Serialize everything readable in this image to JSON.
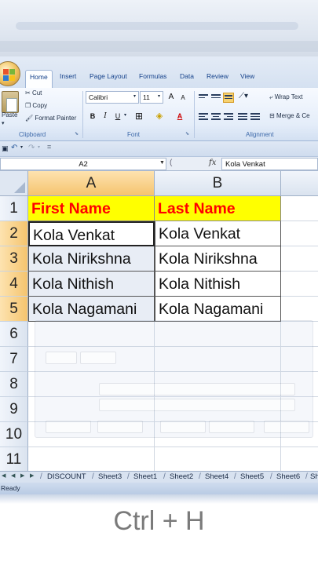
{
  "ribbon": {
    "tabs": [
      {
        "label": "Home",
        "active": true
      },
      {
        "label": "Insert"
      },
      {
        "label": "Page Layout"
      },
      {
        "label": "Formulas"
      },
      {
        "label": "Data"
      },
      {
        "label": "Review"
      },
      {
        "label": "View"
      }
    ],
    "clipboard": {
      "paste": "Paste",
      "cut": "Cut",
      "copy": "Copy",
      "format_painter": "Format Painter",
      "group_label": "Clipboard"
    },
    "font": {
      "name": "Calibri",
      "size": "11",
      "bold": "B",
      "italic": "I",
      "underline": "U",
      "grow": "A",
      "shrink": "A",
      "font_color": "A",
      "group_label": "Font"
    },
    "alignment": {
      "wrap_text": "Wrap Text",
      "merge_center": "Merge & Ce",
      "group_label": "Alignment"
    }
  },
  "formula_bar": {
    "name_box": "A2",
    "fx": "fx",
    "value": "Kola Venkat"
  },
  "grid": {
    "columns": [
      "A",
      "B"
    ],
    "rows": [
      "1",
      "2",
      "3",
      "4",
      "5",
      "6",
      "7",
      "8",
      "9",
      "10",
      "11"
    ],
    "header": {
      "a": "First Name",
      "b": "Last Name"
    },
    "data": [
      {
        "a": "Kola Venkat",
        "b": "Kola Venkat"
      },
      {
        "a": "Kola Nirikshna",
        "b": "Kola Nirikshna"
      },
      {
        "a": "Kola Nithish",
        "b": "Kola Nithish"
      },
      {
        "a": "Kola Nagamani",
        "b": "Kola Nagamani"
      }
    ]
  },
  "sheets": [
    "DISCOUNT",
    "Sheet3",
    "Sheet1",
    "Sheet2",
    "Sheet4",
    "Sheet5",
    "Sheet6",
    "Sh"
  ],
  "status": "Ready",
  "caption": "Ctrl + H",
  "colors": {
    "header_fill": "#ffff00",
    "header_text": "#ff0000",
    "selected_header": "#f5c46e",
    "ribbon_text": "#15428b"
  }
}
